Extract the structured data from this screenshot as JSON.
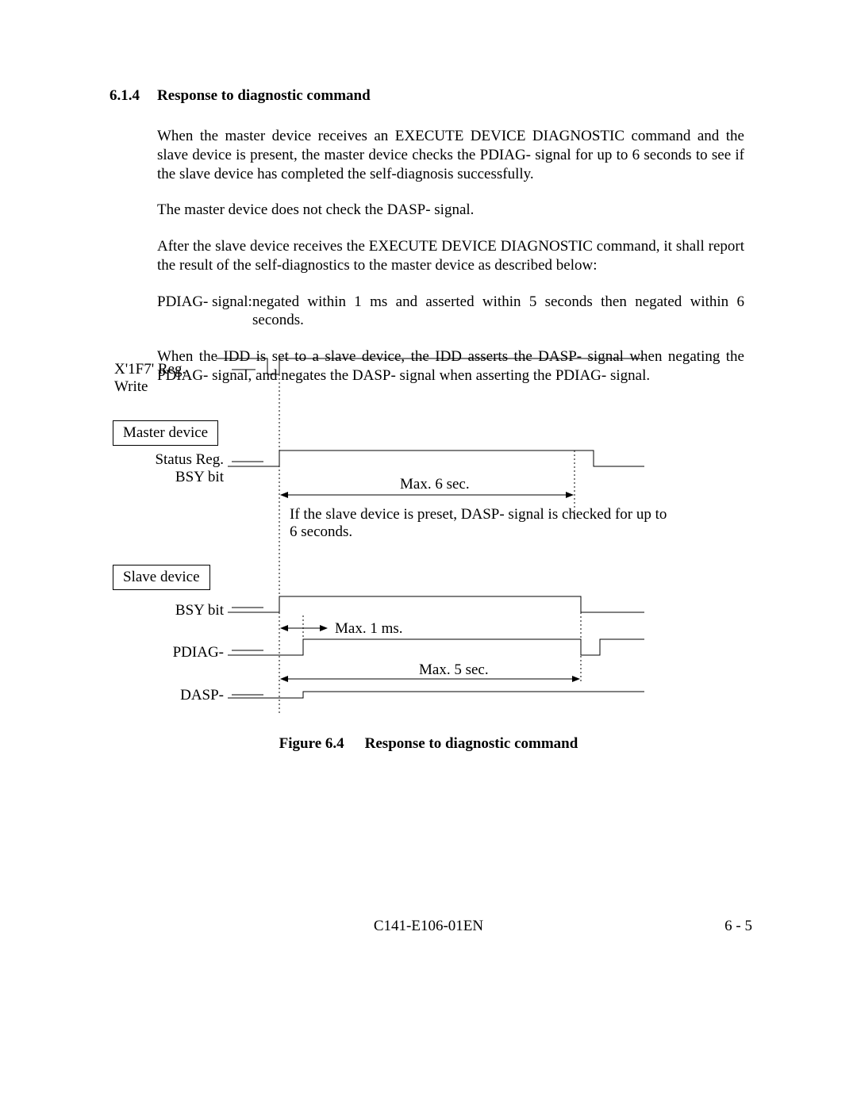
{
  "section": {
    "number": "6.1.4",
    "title": "Response to diagnostic command"
  },
  "paragraphs": {
    "p1": "When the master device receives an EXECUTE DEVICE DIAGNOSTIC command and the slave device is present, the master device checks the PDIAG- signal for up to 6 seconds to see if the slave device has completed the self-diagnosis successfully.",
    "p2": "The master device does not check the DASP- signal.",
    "p3": "After the slave device receives the EXECUTE DEVICE DIAGNOSTIC command, it shall report the result of the self-diagnostics to the master device as described below:",
    "p4_label": "PDIAG- signal:",
    "p4_text": "negated within 1 ms and asserted within 5 seconds then negated within 6 seconds.",
    "p5": "When the IDD is set to a slave device, the IDD asserts the DASP- signal when negating the PDIAG- signal, and negates the DASP- signal when asserting the PDIAG- signal."
  },
  "diagram": {
    "reg_write_l1": "X'1F7' Reg.",
    "reg_write_l2": "Write",
    "master_box": "Master device",
    "status_reg_l1": "Status Reg.",
    "status_reg_l2": "BSY bit",
    "max6": "Max. 6 sec.",
    "note_l1": "If the slave device is preset, DASP- signal is checked for up to",
    "note_l2": "6 seconds.",
    "slave_box": "Slave device",
    "bsy_bit": "BSY bit",
    "max1": "Max. 1 ms.",
    "pdiag": "PDIAG-",
    "max5": "Max. 5 sec.",
    "dasp": "DASP-"
  },
  "figure": {
    "number": "Figure 6.4",
    "caption": "Response to diagnostic command"
  },
  "footer": {
    "center": "C141-E106-01EN",
    "right": "6 - 5"
  }
}
